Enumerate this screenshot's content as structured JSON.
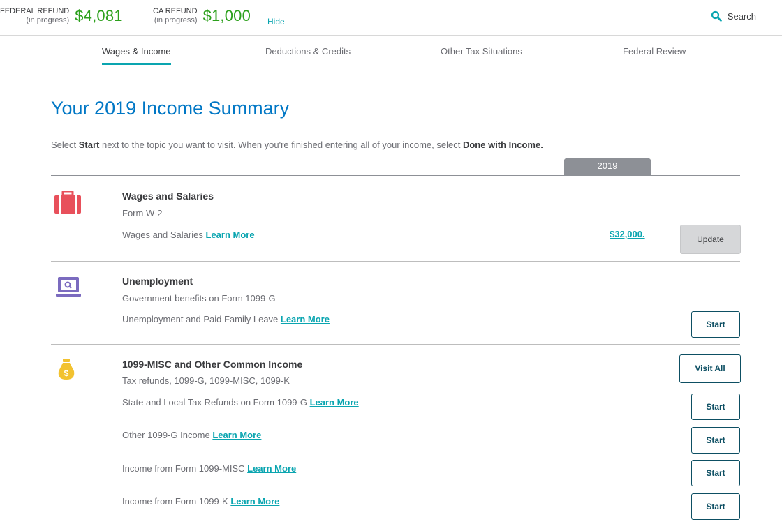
{
  "header": {
    "federal_label": "FEDERAL REFUND",
    "federal_sub": "(in progress)",
    "federal_amount": "$4,081",
    "state_label": "CA REFUND",
    "state_sub": "(in progress)",
    "state_amount": "$1,000",
    "hide_label": "Hide",
    "search_label": "Search"
  },
  "tabs": [
    {
      "label": "Wages & Income",
      "active": true
    },
    {
      "label": "Deductions & Credits",
      "active": false
    },
    {
      "label": "Other Tax Situations",
      "active": false
    },
    {
      "label": "Federal Review",
      "active": false
    }
  ],
  "page": {
    "title": "Your 2019 Income Summary",
    "intro_pre": "Select ",
    "intro_start": "Start",
    "intro_mid": " next to the topic you want to visit. When you're finished entering all of your income, select ",
    "intro_done": "Done with Income.",
    "year": "2019"
  },
  "sections": [
    {
      "icon": "briefcase-icon",
      "title": "Wages and Salaries",
      "subtitle": "Form W-2",
      "items": [
        {
          "text": "Wages and Salaries ",
          "link": "Learn More",
          "amount": "$32,000.",
          "button": "Update"
        }
      ]
    },
    {
      "icon": "laptop-icon",
      "title": "Unemployment",
      "subtitle": "Government benefits on Form 1099-G",
      "items": [
        {
          "text": "Unemployment and Paid Family Leave ",
          "link": "Learn More",
          "button": "Start"
        }
      ]
    },
    {
      "icon": "money-bag-icon",
      "title": "1099-MISC and Other Common Income",
      "subtitle": "Tax refunds, 1099-G, 1099-MISC, 1099-K",
      "visit_all": "Visit All",
      "items": [
        {
          "text": "State and Local Tax Refunds on Form 1099-G ",
          "link": "Learn More",
          "button": "Start"
        },
        {
          "text": "Other 1099-G Income ",
          "link": "Learn More",
          "button": "Start"
        },
        {
          "text": "Income from Form 1099-MISC ",
          "link": "Learn More",
          "button": "Start"
        },
        {
          "text": "Income from Form 1099-K ",
          "link": "Learn More",
          "button": "Start"
        }
      ]
    }
  ],
  "colors": {
    "refund_green": "#2ca01c",
    "accent_teal": "#0aa5b0",
    "title_blue": "#0077c5",
    "button_border": "#0d4f63",
    "briefcase": "#e8505b",
    "laptop": "#7b6bbf",
    "money_bag": "#f2c230"
  }
}
